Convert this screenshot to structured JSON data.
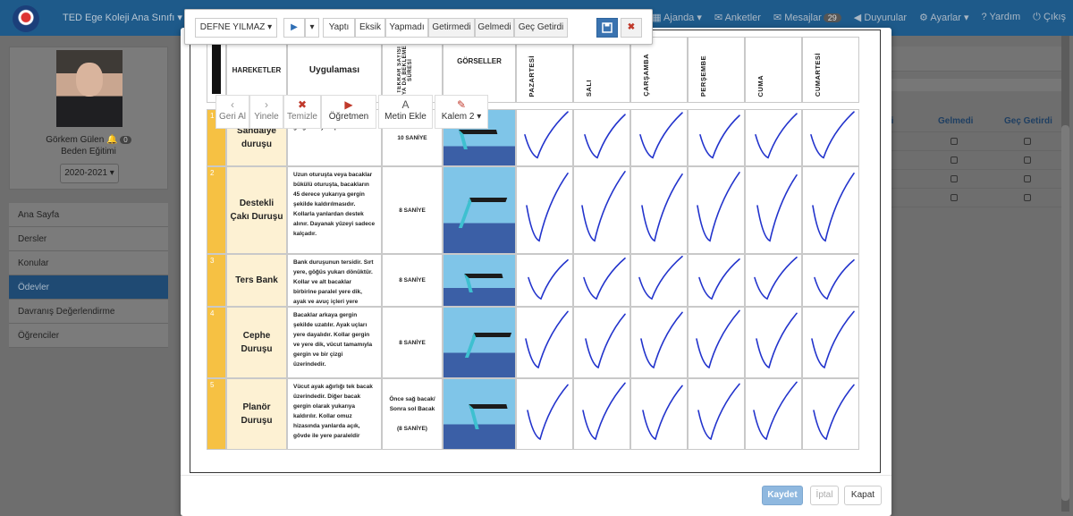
{
  "topbar": {
    "school_name": "TED Ege Koleji Ana Sınıfı ▾",
    "items": [
      {
        "label": "Ajanda ▾",
        "icon": "calendar-icon"
      },
      {
        "label": "Anketler",
        "icon": "chat-icon"
      },
      {
        "label": "Mesajlar",
        "icon": "envelope-icon",
        "badge": "29"
      },
      {
        "label": "Duyurular",
        "icon": "megaphone-icon"
      },
      {
        "label": "Ayarlar ▾",
        "icon": "gear-icon"
      },
      {
        "label": "Yardım",
        "icon": "question-icon"
      },
      {
        "label": "Çıkış",
        "icon": "power-icon"
      }
    ]
  },
  "profile": {
    "name": "Görkem Gülen",
    "notification_count": "0",
    "department": "Beden Eğitimi",
    "year": "2020-2021 ▾"
  },
  "leftmenu": {
    "items": [
      "Ana Sayfa",
      "Dersler",
      "Konular",
      "Ödevler",
      "Davranış Değerlendirme",
      "Öğrenciler"
    ],
    "active_index": 3
  },
  "background_table": {
    "headers": [
      "edi",
      "Gelmedi",
      "Geç Getirdi"
    ],
    "rows": 4
  },
  "toolbar": {
    "student": "DEFNE YILMAZ ▾",
    "play": "▶",
    "play_caret": "▾",
    "status_buttons": [
      "Yaptı",
      "Eksik",
      "Yapmadı",
      "Getirmedi",
      "Gelmedi",
      "Geç Getirdi"
    ],
    "save_icon": "floppy-icon",
    "delete_icon": "close-icon"
  },
  "drawing_toolbar": {
    "buttons": [
      {
        "label": "Geri Al",
        "icon": "‹"
      },
      {
        "label": "Yinele",
        "icon": "›"
      },
      {
        "label": "Temizle",
        "icon": "✖"
      },
      {
        "label": "Öğretmen",
        "icon": "▶"
      },
      {
        "label": "Metin Ekle",
        "icon": "A"
      },
      {
        "label": "Kalem 2 ▾",
        "icon": "✎"
      }
    ]
  },
  "worksheet": {
    "headers": {
      "movements": "HAREKETLER",
      "application": "Uygulaması",
      "repeat": "TEKRAR SAYISI YA DA BEKLEME SÜRESİ",
      "images": "GÖRSELLER"
    },
    "days": [
      "PAZARTESİ",
      "SALI",
      "ÇARŞAMBA",
      "PERŞEMBE",
      "CUMA",
      "CUMARTESİ"
    ],
    "rows": [
      {
        "num": "1",
        "name": "Sandalye\nduruşu",
        "desc": "Kollar omuz hizasında açık, gergin ve yere paralelde.",
        "duration": "10 SANİYE"
      },
      {
        "num": "2",
        "name": "Destekli\nÇakı Duruşu",
        "desc": "Uzun oturuşta veya bacaklar bükülü oturuşta, bacakların 45 derece yukarıya gergin şekilde kaldırılmasıdır. Kollarla yanlardan destek alınır. Dayanak yüzeyi sadece kalçadır.",
        "duration": "8 SANİYE"
      },
      {
        "num": "3",
        "name": "Ters Bank",
        "desc": "Bank duruşunun tersidir. Sırt yere, göğüs yukarı dönüktür. Kollar ve alt bacaklar birbirine paralel yere dik, ayak ve avuç içleri yere dayalıdır. Baş arkada sabittir",
        "duration": "8 SANİYE"
      },
      {
        "num": "4",
        "name": "Cephe\nDuruşu",
        "desc": "Bacaklar arkaya gergin şekilde uzatılır. Ayak uçları yere dayalıdır. Kollar gergin ve yere dik, vücut tamamıyla gergin ve bir çizgi üzerindedir.",
        "duration": "8 SANİYE"
      },
      {
        "num": "5",
        "name": "Planör\nDuruşu",
        "desc": "Vücut ayak ağırlığı tek bacak üzerindedir. Diğer bacak gergin olarak yukarıya kaldırılır. Kollar omuz hizasında yanlarda açık, gövde ile yere paraleldir",
        "duration": "Önce sağ bacak/\nSonra sol Bacak\n\n(8 SANİYE)"
      }
    ]
  },
  "footer": {
    "save": "Kaydet",
    "cancel": "İptal",
    "close": "Kapat"
  },
  "colors": {
    "nav": "#1e5a8a",
    "accent": "#3a73b0",
    "number_tab": "#f6c143",
    "name_cell": "#fdf1d3",
    "check_ink": "#2233cc"
  }
}
